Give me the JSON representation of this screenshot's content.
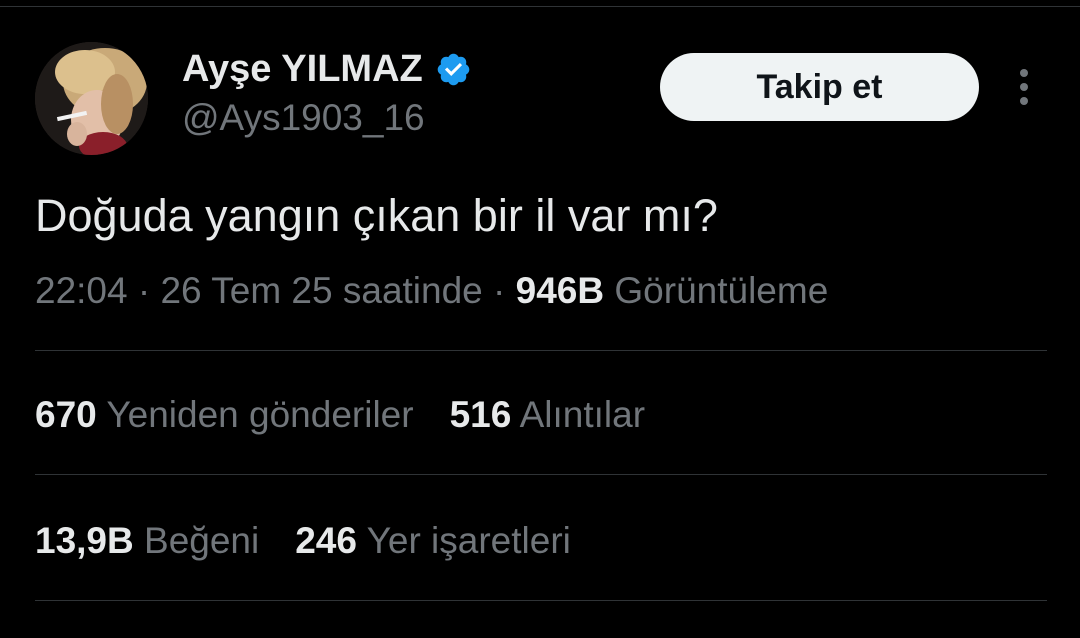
{
  "user": {
    "display_name": "Ayşe YILMAZ",
    "handle": "@Ays1903_16",
    "verified_icon": "verified-badge-icon",
    "verified_color": "#1d9bf0"
  },
  "actions": {
    "follow_label": "Takip et",
    "more_icon": "more-vertical-icon"
  },
  "tweet": {
    "text": "Doğuda yangın çıkan bir il var mı?",
    "time": "22:04",
    "sep1": " · ",
    "date": "26 Tem 25 saatinde",
    "sep2": " · ",
    "views_count": "946B",
    "views_label": " Görüntüleme"
  },
  "stats": {
    "reposts": {
      "count": "670",
      "label": "Yeniden gönderiler"
    },
    "quotes": {
      "count": "516",
      "label": "Alıntılar"
    },
    "likes": {
      "count": "13,9B",
      "label": "Beğeni"
    },
    "bookmarks": {
      "count": "246",
      "label": "Yer işaretleri"
    }
  },
  "colors": {
    "background": "#000000",
    "text_primary": "#e7e9ea",
    "text_secondary": "#71767b",
    "divider": "#2f3336",
    "button_bg": "#eff3f4"
  }
}
